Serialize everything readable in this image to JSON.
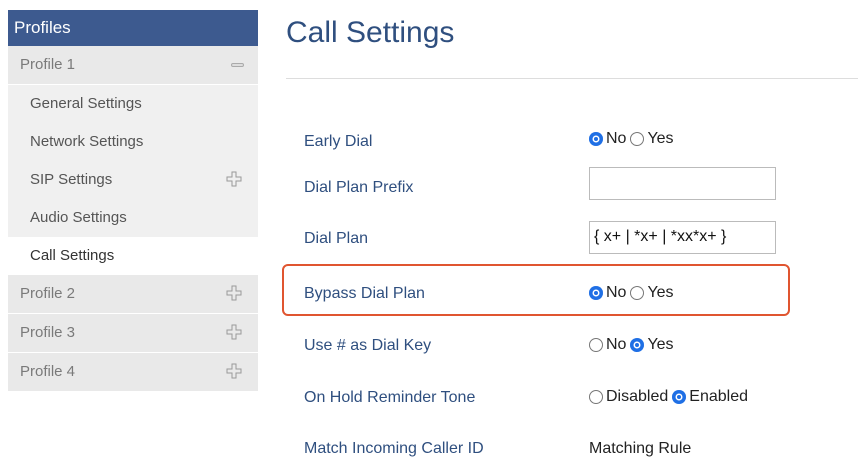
{
  "sidebar": {
    "header": "Profiles",
    "profile1": "Profile 1",
    "sub": [
      "General Settings",
      "Network Settings",
      "SIP Settings",
      "Audio Settings",
      "Call Settings"
    ],
    "profile2": "Profile 2",
    "profile3": "Profile 3",
    "profile4": "Profile 4"
  },
  "page": {
    "title": "Call Settings"
  },
  "settings": {
    "early_dial": {
      "label": "Early Dial",
      "opt1": "No",
      "opt2": "Yes",
      "selected": "No"
    },
    "dial_plan_prefix": {
      "label": "Dial Plan Prefix",
      "value": ""
    },
    "dial_plan": {
      "label": "Dial Plan",
      "value": "{ x+ | *x+ | *xx*x+ }"
    },
    "bypass_dial_plan": {
      "label": "Bypass Dial Plan",
      "opt1": "No",
      "opt2": "Yes",
      "selected": "No"
    },
    "use_hash": {
      "label": "Use # as Dial Key",
      "opt1": "No",
      "opt2": "Yes",
      "selected": "Yes"
    },
    "on_hold": {
      "label": "On Hold Reminder Tone",
      "opt1": "Disabled",
      "opt2": "Enabled",
      "selected": "Enabled"
    },
    "match_caller": {
      "label": "Match Incoming Caller ID",
      "value": "Matching Rule"
    }
  },
  "colors": {
    "accent": "#3d5a8f",
    "radio": "#1f6fe5",
    "highlight": "#e05530"
  }
}
